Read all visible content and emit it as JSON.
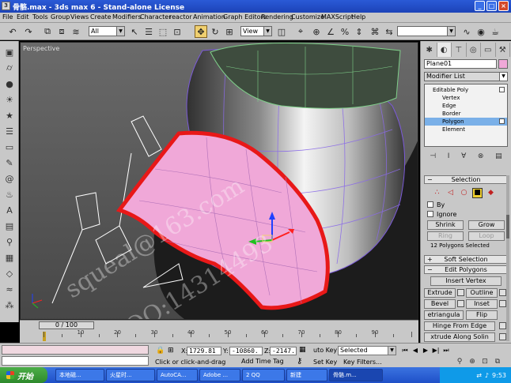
{
  "window": {
    "title": "骨骼.max - 3ds max 6 - Stand-alone License",
    "icon_label": "3",
    "controls": [
      "minimize-icon",
      "maximize-icon",
      "close-icon"
    ]
  },
  "menu": [
    "File",
    "Edit",
    "Tools",
    "Group",
    "Views",
    "Create",
    "Modifiers",
    "Character",
    "reactor",
    "Animation",
    "Graph Editors",
    "Rendering",
    "Customize",
    "MAXScript",
    "Help"
  ],
  "toolbar": {
    "selection_filter": "All",
    "ref_coord": "View",
    "named_selection": ""
  },
  "viewport": {
    "label": "Perspective",
    "watermarks": [
      "squeal@163.com",
      "QQ:14314493"
    ]
  },
  "command_panel": {
    "object_name": "Plane01",
    "object_color": "#f0a8d8",
    "modifier_list_label": "Modifier List",
    "stack": [
      {
        "label": "Editable Poly",
        "level": "top"
      },
      {
        "label": "Vertex",
        "level": "sub"
      },
      {
        "label": "Edge",
        "level": "sub"
      },
      {
        "label": "Border",
        "level": "sub"
      },
      {
        "label": "Polygon",
        "level": "sub",
        "selected": true
      },
      {
        "label": "Element",
        "level": "sub"
      }
    ],
    "selection_rollout": "Selection",
    "by_label": "By",
    "ignore_label": "Ignore",
    "shrink_label": "Shrink",
    "grow_label": "Grow",
    "ring_label": "Ring",
    "loop_label": "Loop",
    "selection_status": "12 Polygons Selected",
    "soft_selection_rollout": "Soft Selection",
    "edit_polygons_rollout": "Edit Polygons",
    "insert_vertex_label": "Insert Vertex",
    "extrude_label": "Extrude",
    "outline_label": "Outline",
    "bevel_label": "Bevel",
    "inset_label": "Inset",
    "retriangulate_label": "etriangula",
    "flip_label": "Flip",
    "hinge_label": "Hinge From Edge",
    "extrude_spline_label": "xtrude Along Solin"
  },
  "timeline": {
    "slider_label": "0 / 100",
    "slider_position": 0,
    "ticks": [
      0,
      10,
      20,
      30,
      40,
      50,
      60,
      70,
      80,
      90,
      100
    ]
  },
  "status": {
    "x_label": "X:",
    "x_value": "1729.81",
    "y_label": "Y:",
    "y_value": "-10860.",
    "z_label": "Z:",
    "z_value": "-2147.",
    "prompt": "Click or click-and-drag",
    "add_time_tag": "Add Time Tag",
    "auto_key": "uto Key",
    "set_key": "Set Key",
    "key_filters": "Key Filters...",
    "key_mode": "Selected"
  },
  "taskbar": {
    "start_label": "开始",
    "tasks": [
      "本地磁...",
      "火星时...",
      "AutoCA...",
      "Adobe ...",
      "2 QQ",
      "新建",
      "骨骼.m..."
    ],
    "clock": "9:53"
  }
}
